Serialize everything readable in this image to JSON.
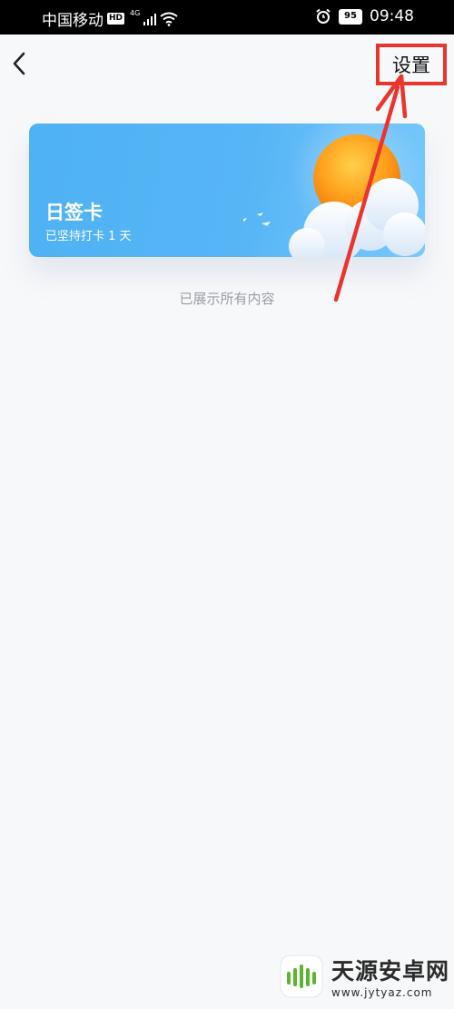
{
  "status_bar": {
    "carrier": "中国移动",
    "hd_badge": "HD",
    "network": "4G",
    "battery": "95",
    "time": "09:48",
    "icons": [
      "signal-icon",
      "wifi-icon",
      "alarm-icon",
      "battery-icon"
    ]
  },
  "nav": {
    "back_icon": "chevron-left-icon",
    "settings_label": "设置"
  },
  "card": {
    "title": "日签卡",
    "subtitle": "已坚持打卡 1 天"
  },
  "list": {
    "end_text": "已展示所有内容"
  },
  "annotation": {
    "highlight_color": "#e8352e"
  },
  "watermark": {
    "title": "天源安卓网",
    "url": "www.jytyaz.com"
  }
}
